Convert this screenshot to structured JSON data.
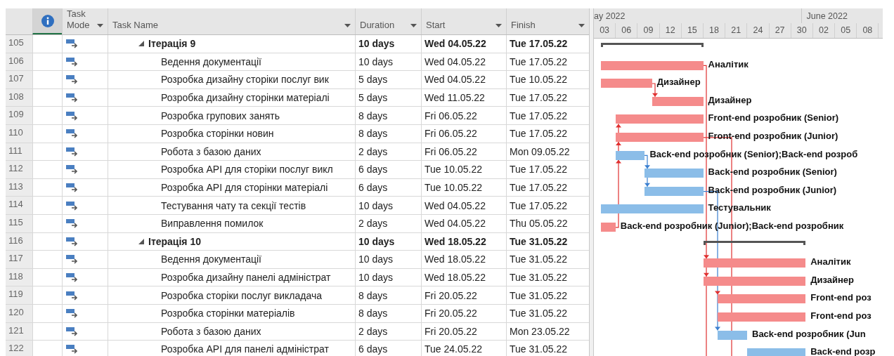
{
  "columns": [
    {
      "kind": "info"
    },
    {
      "kind": "mode",
      "label": "Task Mode",
      "filter": true
    },
    {
      "kind": "name",
      "label": "Task Name",
      "filter": true
    },
    {
      "kind": "duration",
      "label": "Duration",
      "filter": true
    },
    {
      "kind": "start",
      "label": "Start",
      "filter": true
    },
    {
      "kind": "finish",
      "label": "Finish",
      "filter": true
    }
  ],
  "timescale": {
    "months": [
      "ay 2022",
      "June 2022"
    ],
    "days": [
      "03",
      "06",
      "09",
      "12",
      "15",
      "18",
      "21",
      "24",
      "27",
      "30",
      "02",
      "05",
      "08"
    ]
  },
  "rows": [
    {
      "id": "105",
      "kind": "summary",
      "expanded": true,
      "name": "Ітерація 9",
      "duration": "10 days",
      "start": "Wed 04.05.22",
      "finish": "Tue 17.05.22"
    },
    {
      "id": "106",
      "kind": "task",
      "critical": true,
      "name": "Ведення документації",
      "duration": "10 days",
      "start": "Wed 04.05.22",
      "finish": "Tue 17.05.22",
      "resource": "Аналітик"
    },
    {
      "id": "107",
      "kind": "task",
      "critical": true,
      "name": "Розробка дизайну сторіки послуг вик",
      "duration": "5 days",
      "start": "Wed 04.05.22",
      "finish": "Tue 10.05.22",
      "resource": "Дизайнер"
    },
    {
      "id": "108",
      "kind": "task",
      "critical": true,
      "name": "Розробка дизайну сторінки матеріалі",
      "duration": "5 days",
      "start": "Wed 11.05.22",
      "finish": "Tue 17.05.22",
      "resource": "Дизайнер"
    },
    {
      "id": "109",
      "kind": "task",
      "critical": true,
      "name": "Розробка групових занять",
      "duration": "8 days",
      "start": "Fri 06.05.22",
      "finish": "Tue 17.05.22",
      "resource": "Front-end розробник (Senior)"
    },
    {
      "id": "110",
      "kind": "task",
      "critical": true,
      "name": "Розробка сторінки новин",
      "duration": "8 days",
      "start": "Fri 06.05.22",
      "finish": "Tue 17.05.22",
      "resource": "Front-end розробник (Junior)"
    },
    {
      "id": "111",
      "kind": "task",
      "critical": false,
      "name": "Робота з базою даних",
      "duration": "2 days",
      "start": "Fri 06.05.22",
      "finish": "Mon 09.05.22",
      "resource": "Back-end розробник (Senior);Back-end розроб"
    },
    {
      "id": "112",
      "kind": "task",
      "critical": false,
      "name": "Розробка API для сторіки послуг викл",
      "duration": "6 days",
      "start": "Tue 10.05.22",
      "finish": "Tue 17.05.22",
      "resource": "Back-end розробник (Senior)"
    },
    {
      "id": "113",
      "kind": "task",
      "critical": false,
      "name": "Розробка API для сторінки матеріалі",
      "duration": "6 days",
      "start": "Tue 10.05.22",
      "finish": "Tue 17.05.22",
      "resource": "Back-end розробник (Junior)"
    },
    {
      "id": "114",
      "kind": "task",
      "critical": false,
      "name": "Тестування чату та секції тестів",
      "duration": "10 days",
      "start": "Wed 04.05.22",
      "finish": "Tue 17.05.22",
      "resource": "Тестувальник"
    },
    {
      "id": "115",
      "kind": "task",
      "critical": true,
      "name": "Виправлення помилок",
      "duration": "2 days",
      "start": "Wed 04.05.22",
      "finish": "Thu 05.05.22",
      "resource": "Back-end розробник (Junior);Back-end розробник"
    },
    {
      "id": "116",
      "kind": "summary",
      "expanded": true,
      "name": "Ітерація 10",
      "duration": "10 days",
      "start": "Wed 18.05.22",
      "finish": "Tue 31.05.22"
    },
    {
      "id": "117",
      "kind": "task",
      "critical": true,
      "name": "Ведення документації",
      "duration": "10 days",
      "start": "Wed 18.05.22",
      "finish": "Tue 31.05.22",
      "resource": "Аналітик"
    },
    {
      "id": "118",
      "kind": "task",
      "critical": true,
      "name": "Розробка дизайну панелі адміністрат",
      "duration": "10 days",
      "start": "Wed 18.05.22",
      "finish": "Tue 31.05.22",
      "resource": "Дизайнер"
    },
    {
      "id": "119",
      "kind": "task",
      "critical": true,
      "name": "Розробка сторіки послуг викладача",
      "duration": "8 days",
      "start": "Fri 20.05.22",
      "finish": "Tue 31.05.22",
      "resource": "Front-end роз"
    },
    {
      "id": "120",
      "kind": "task",
      "critical": true,
      "name": "Розробка сторінки матеріалів",
      "duration": "8 days",
      "start": "Fri 20.05.22",
      "finish": "Tue 31.05.22",
      "resource": "Front-end роз"
    },
    {
      "id": "121",
      "kind": "task",
      "critical": false,
      "name": "Робота з базою даних",
      "duration": "2 days",
      "start": "Fri 20.05.22",
      "finish": "Mon 23.05.22",
      "resource": "Back-end розробник (Jun"
    },
    {
      "id": "122",
      "kind": "task",
      "critical": false,
      "name": "Розробка API для панелі адміністрат",
      "duration": "6 days",
      "start": "Tue 24.05.22",
      "finish": "Tue 31.05.22",
      "resource": "Back-end розр"
    }
  ]
}
